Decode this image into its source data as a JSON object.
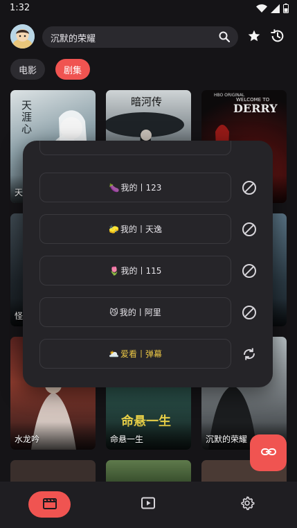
{
  "status_bar": {
    "time": "1:32",
    "icons": [
      "wifi-icon",
      "signal-icon",
      "battery-icon"
    ]
  },
  "header": {
    "search_text": "沉默的荣耀",
    "icons": [
      "search-icon",
      "star-icon",
      "history-icon"
    ]
  },
  "categories": [
    {
      "label": "电影",
      "selected": false
    },
    {
      "label": "剧集",
      "selected": true
    }
  ],
  "posters": [
    {
      "title": "天"
    },
    {
      "title": ""
    },
    {
      "title": ""
    },
    {
      "title": "怪"
    },
    {
      "title": ""
    },
    {
      "title": ""
    },
    {
      "title": "水龙吟"
    },
    {
      "title": "命悬一生"
    },
    {
      "title": "沉默的荣耀"
    }
  ],
  "poster_art_text": {
    "p1": "天涯心",
    "p2": "暗河传",
    "p3_brand": "HBO ORIGINAL",
    "p3_welcome": "WELCOME TO",
    "p3_name": "DERRY",
    "p8": "命悬一生"
  },
  "sources": [
    {
      "emoji": "🍆",
      "label": "我的丨123",
      "action": "disable-icon",
      "active": false
    },
    {
      "emoji": "🧽",
      "label": "我的丨天逸",
      "action": "disable-icon",
      "active": false
    },
    {
      "emoji": "🌷",
      "label": "我的丨115",
      "action": "disable-icon",
      "active": false
    },
    {
      "emoji": "😼",
      "label": "我的丨阿里",
      "action": "disable-icon",
      "active": false
    },
    {
      "emoji": "🌥️",
      "label": "爱看丨弹幕",
      "action": "refresh-icon",
      "active": true
    }
  ],
  "colors": {
    "accent": "#f05451",
    "background": "#151417",
    "sheet": "#252428",
    "active_text": "#e9c545"
  },
  "bottom_nav": [
    {
      "name": "home",
      "icon": "film-icon",
      "selected": true
    },
    {
      "name": "player",
      "icon": "play-icon",
      "selected": false
    },
    {
      "name": "settings",
      "icon": "gear-icon",
      "selected": false
    }
  ]
}
